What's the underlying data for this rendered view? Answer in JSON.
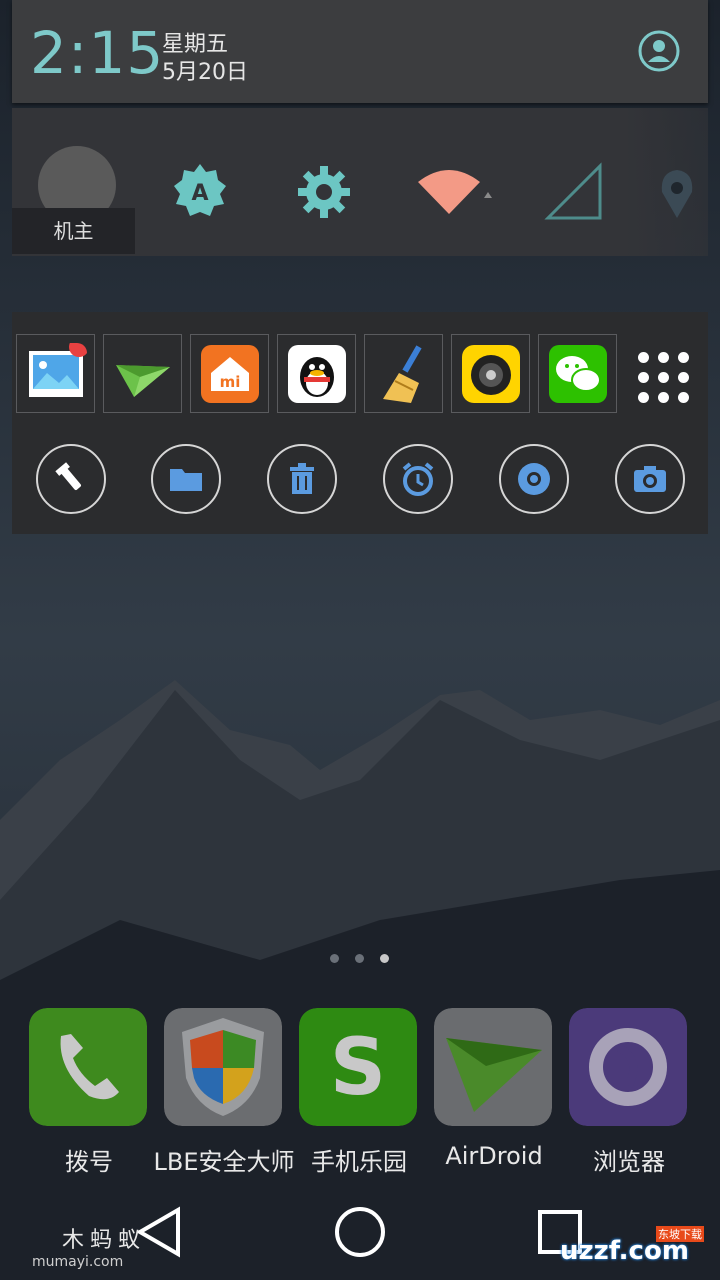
{
  "status": {
    "time": "2:15",
    "weekday": "星期五",
    "date": "5月20日"
  },
  "quick_settings": {
    "owner_label": "机主"
  },
  "floating_panel": {
    "apps": [
      "gallery-app-icon",
      "airdroid-app-icon",
      "mi-store-app-icon",
      "qq-app-icon",
      "cleaner-app-icon",
      "camera360-app-icon",
      "wechat-app-icon"
    ],
    "tools": [
      "flashlight-icon",
      "folder-icon",
      "trash-icon",
      "alarm-icon",
      "chrome-icon",
      "camera-icon"
    ]
  },
  "dock": {
    "items": [
      {
        "label": "拨号",
        "icon": "phone-icon"
      },
      {
        "label": "LBE安全大师",
        "icon": "shield-icon"
      },
      {
        "label": "手机乐园",
        "icon": "s-store-icon"
      },
      {
        "label": "AirDroid",
        "icon": "paper-plane-icon"
      },
      {
        "label": "浏览器",
        "icon": "browser-icon"
      }
    ]
  },
  "watermark": {
    "left_main": "木蚂蚁",
    "left_sub": "mumayi.com",
    "right": "uzzf.com",
    "right_sub": "东坡下载"
  },
  "colors": {
    "accent": "#7ec9c9",
    "panel": "#2b2c2e",
    "tool_icon": "#5b9be0"
  }
}
